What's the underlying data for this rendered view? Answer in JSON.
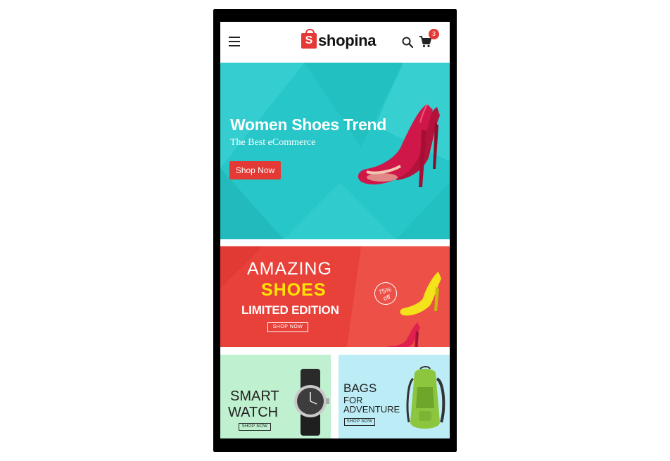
{
  "header": {
    "logo_letter": "S",
    "logo_text": "shopina",
    "cart_count": "3",
    "icons": [
      "menu-icon",
      "search-icon",
      "cart-icon"
    ]
  },
  "hero": {
    "title": "Women Shoes Trend",
    "subtitle": "The Best eCommerce",
    "button": "Shop Now",
    "slides": 4,
    "active_slide": 2,
    "color": "#26c6c9"
  },
  "banner": {
    "line1": "AMAZING",
    "line2": "SHOES",
    "line3": "LIMITED EDITION",
    "button": "SHOP NOW",
    "discount": "75%",
    "discount_suffix": "off",
    "color": "#e8413a"
  },
  "tiles": [
    {
      "line1": "SMART",
      "line2": "WATCH",
      "button": "SHOP NOW"
    },
    {
      "line1": "BAGS",
      "line2": "FOR",
      "line3": "ADVENTURE",
      "button": "SHOP NOW"
    }
  ]
}
